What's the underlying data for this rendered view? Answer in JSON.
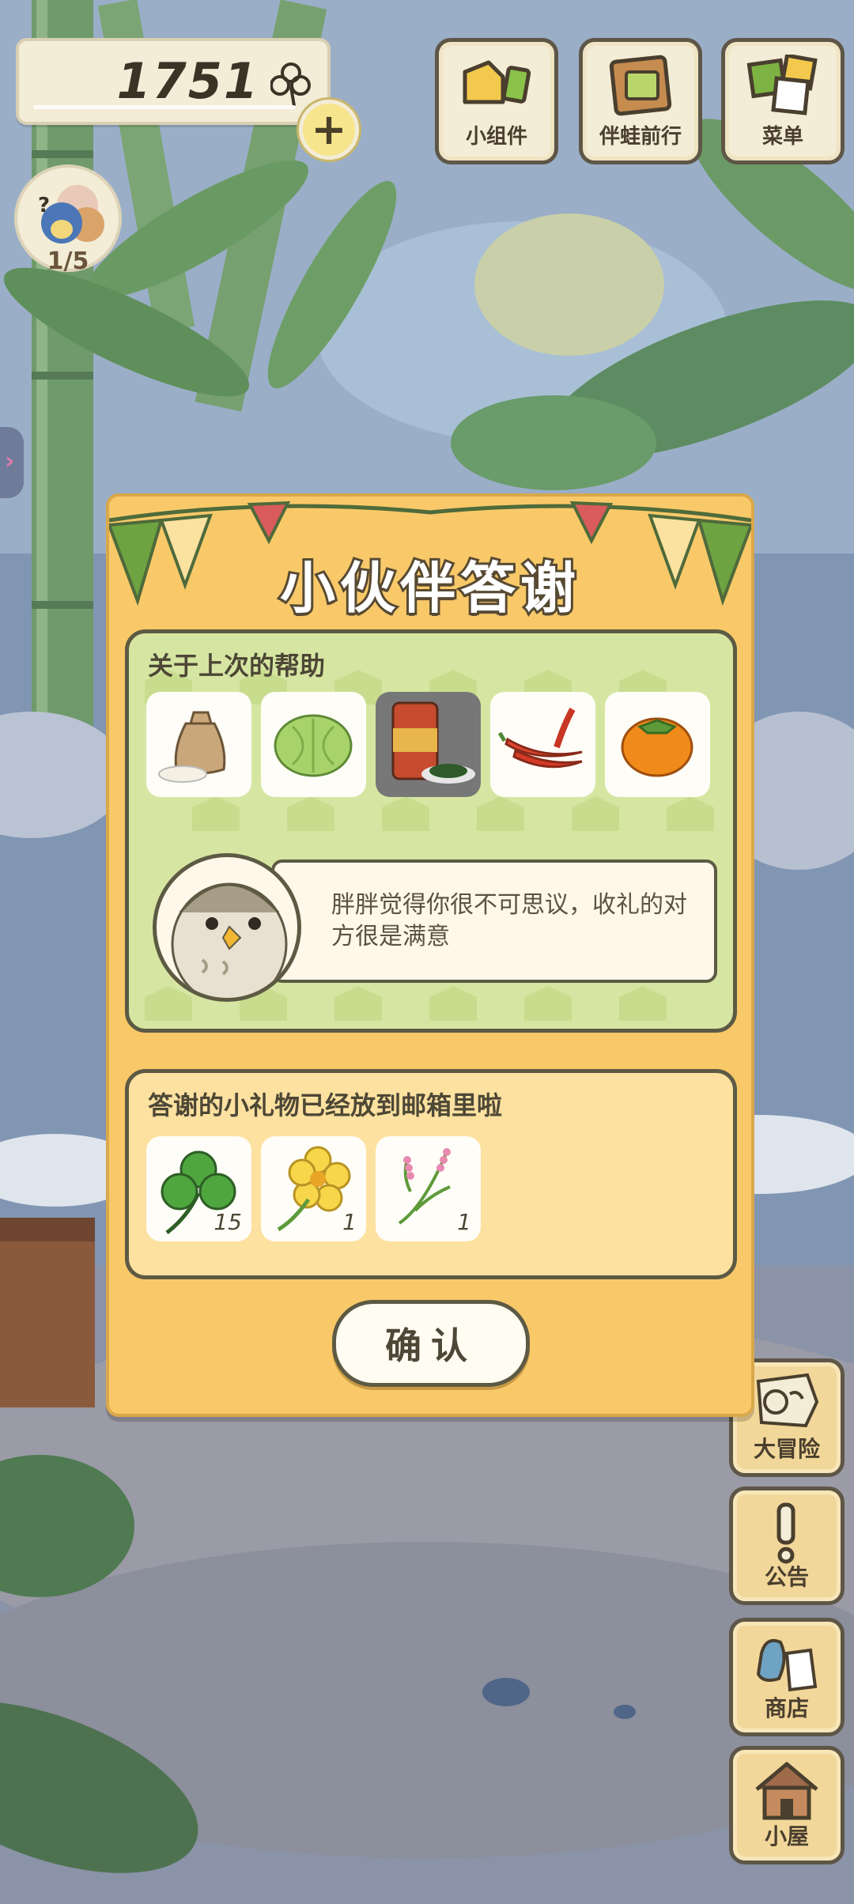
{
  "hud": {
    "clover_count": "1751",
    "friend_badge_label": "1/5"
  },
  "top_menu": [
    {
      "label": "小组件",
      "icon": "widget-icon"
    },
    {
      "label": "伴蛙前行",
      "icon": "journey-icon"
    },
    {
      "label": "菜单",
      "icon": "menu-icon"
    }
  ],
  "side_menu": [
    {
      "label": "大冒险",
      "icon": "adventure-map-icon"
    },
    {
      "label": "公告",
      "icon": "notice-icon"
    },
    {
      "label": "商店",
      "icon": "shop-bag-icon"
    },
    {
      "label": "小屋",
      "icon": "house-icon"
    }
  ],
  "dialog": {
    "title": "小伙伴答谢",
    "help_heading": "关于上次的帮助",
    "help_items": [
      {
        "name": "rice-sack-icon"
      },
      {
        "name": "cabbage-icon"
      },
      {
        "name": "spice-jar-icon",
        "dimmed": true
      },
      {
        "name": "chili-pepper-icon"
      },
      {
        "name": "persimmon-icon"
      }
    ],
    "message": "胖胖觉得你很不可思议，收礼的对方很是满意",
    "gift_heading": "答谢的小礼物已经放到邮箱里啦",
    "gifts": [
      {
        "name": "clover-icon",
        "qty": "15"
      },
      {
        "name": "yellow-flower-icon",
        "qty": "1"
      },
      {
        "name": "pink-herb-icon",
        "qty": "1"
      }
    ],
    "confirm_label": "确认"
  },
  "colors": {
    "dialog_bg": "#f9c969",
    "help_panel_bg": "#d6e6a2",
    "gift_panel_bg": "#fde1a0",
    "outline": "#5d5a44"
  }
}
